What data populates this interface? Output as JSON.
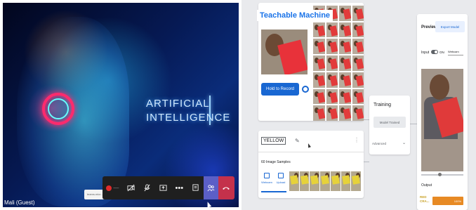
{
  "meeting": {
    "guest_label": "Mali (Guest)",
    "share_chip_label": "teams.micr...",
    "slide_title_line1": "ARTIFICIAL",
    "slide_title_line2": "INTELLIGENCE",
    "controls": {
      "more_label": "•••"
    }
  },
  "teachable_machine": {
    "app_title": "Teachable Machine",
    "hold_to_record": "Hold to Record",
    "class_name": "YELLOW",
    "image_samples": "60 Image Samples",
    "webcam_tool": "Webcam",
    "upload_tool": "Upload",
    "training": {
      "title": "Training",
      "button": "Model Trained",
      "advanced": "Advanced"
    },
    "preview": {
      "title": "Preview",
      "export": "Export Model",
      "input_label": "Input",
      "input_state": "ON",
      "source": "Webcam",
      "output_label": "Output",
      "output_class": "RED",
      "output_class_line2": "CRA...",
      "output_percent": "100%"
    }
  },
  "colors": {
    "accent": "#1967d2",
    "hangup": "#c4314b",
    "people": "#5b5fc7",
    "output_bar": "#e78a24"
  }
}
